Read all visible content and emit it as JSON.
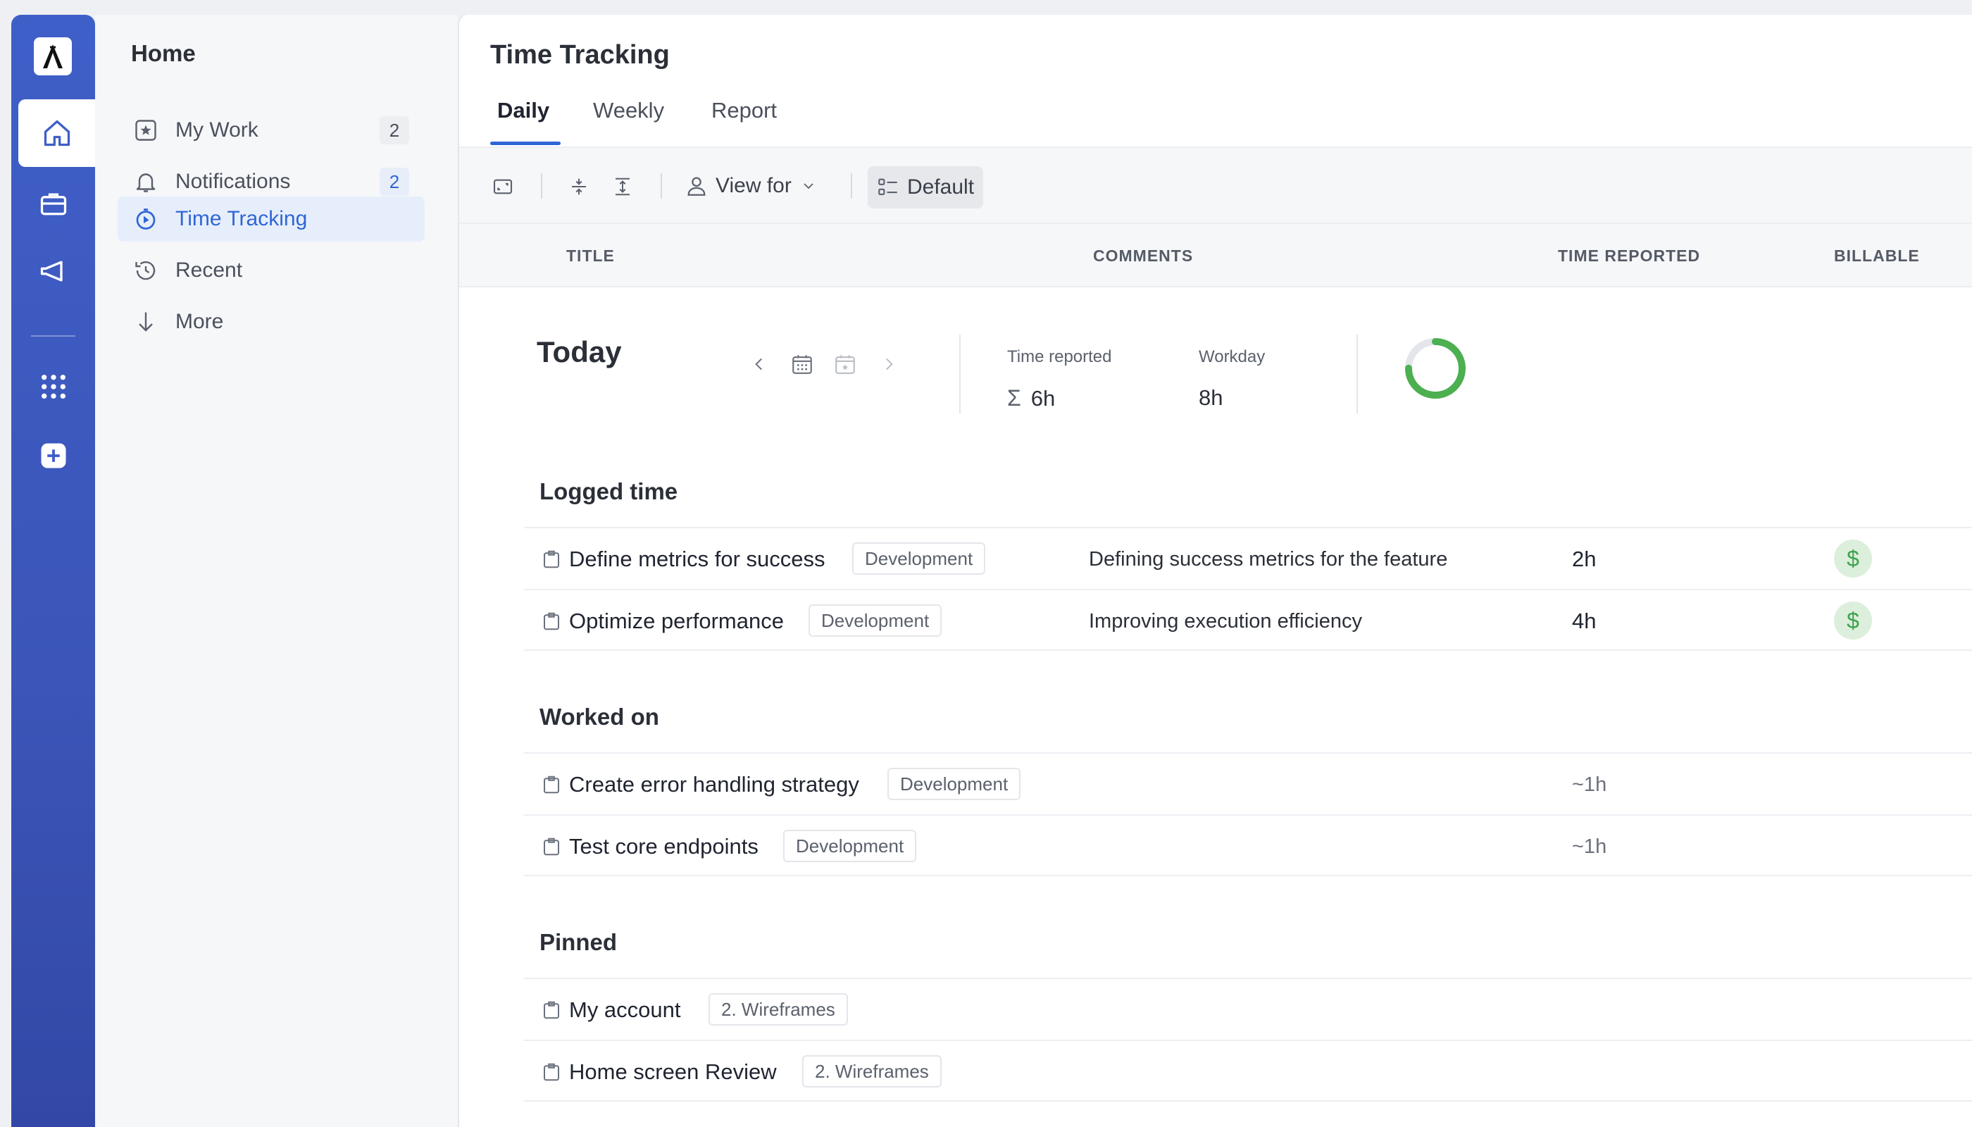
{
  "sidebar": {
    "title": "Home",
    "items": [
      {
        "label": "My Work",
        "count": "2",
        "icon": "star-square-icon"
      },
      {
        "label": "Notifications",
        "count": "2",
        "icon": "bell-icon"
      },
      {
        "label": "Time Tracking",
        "icon": "stopwatch-icon",
        "active": true
      },
      {
        "label": "Recent",
        "icon": "history-icon"
      },
      {
        "label": "More",
        "icon": "arrow-down-icon"
      }
    ]
  },
  "main": {
    "title": "Time Tracking",
    "tabs": [
      {
        "label": "Daily",
        "active": true
      },
      {
        "label": "Weekly"
      },
      {
        "label": "Report"
      }
    ],
    "toolbar": {
      "view_for": "View for",
      "default": "Default"
    },
    "columns": {
      "title": "TITLE",
      "comments": "COMMENTS",
      "time_reported": "TIME REPORTED",
      "billable": "BILLABLE"
    },
    "summary": {
      "day": "Today",
      "time_reported_label": "Time reported",
      "time_reported_value": "6h",
      "workday_label": "Workday",
      "workday_value": "8h",
      "progress": 0.75
    },
    "sections": {
      "logged": {
        "title": "Logged time",
        "rows": [
          {
            "title": "Define metrics for success",
            "tag": "Development",
            "comment": "Defining success metrics for the feature",
            "time": "2h",
            "billable": "$"
          },
          {
            "title": "Optimize performance",
            "tag": "Development",
            "comment": "Improving execution efficiency",
            "time": "4h",
            "billable": "$"
          }
        ]
      },
      "worked": {
        "title": "Worked on",
        "rows": [
          {
            "title": "Create error handling strategy",
            "tag": "Development",
            "time": "~1h"
          },
          {
            "title": "Test core endpoints",
            "tag": "Development",
            "time": "~1h"
          }
        ]
      },
      "pinned": {
        "title": "Pinned",
        "rows": [
          {
            "title": "My account",
            "tag": "2. Wireframes"
          },
          {
            "title": "Home screen Review",
            "tag": "2. Wireframes"
          }
        ]
      }
    }
  },
  "colors": {
    "rail": "#3f5fc8",
    "accent": "#2f66d6",
    "progress": "#4caf50",
    "billable": "#3fa34d"
  }
}
